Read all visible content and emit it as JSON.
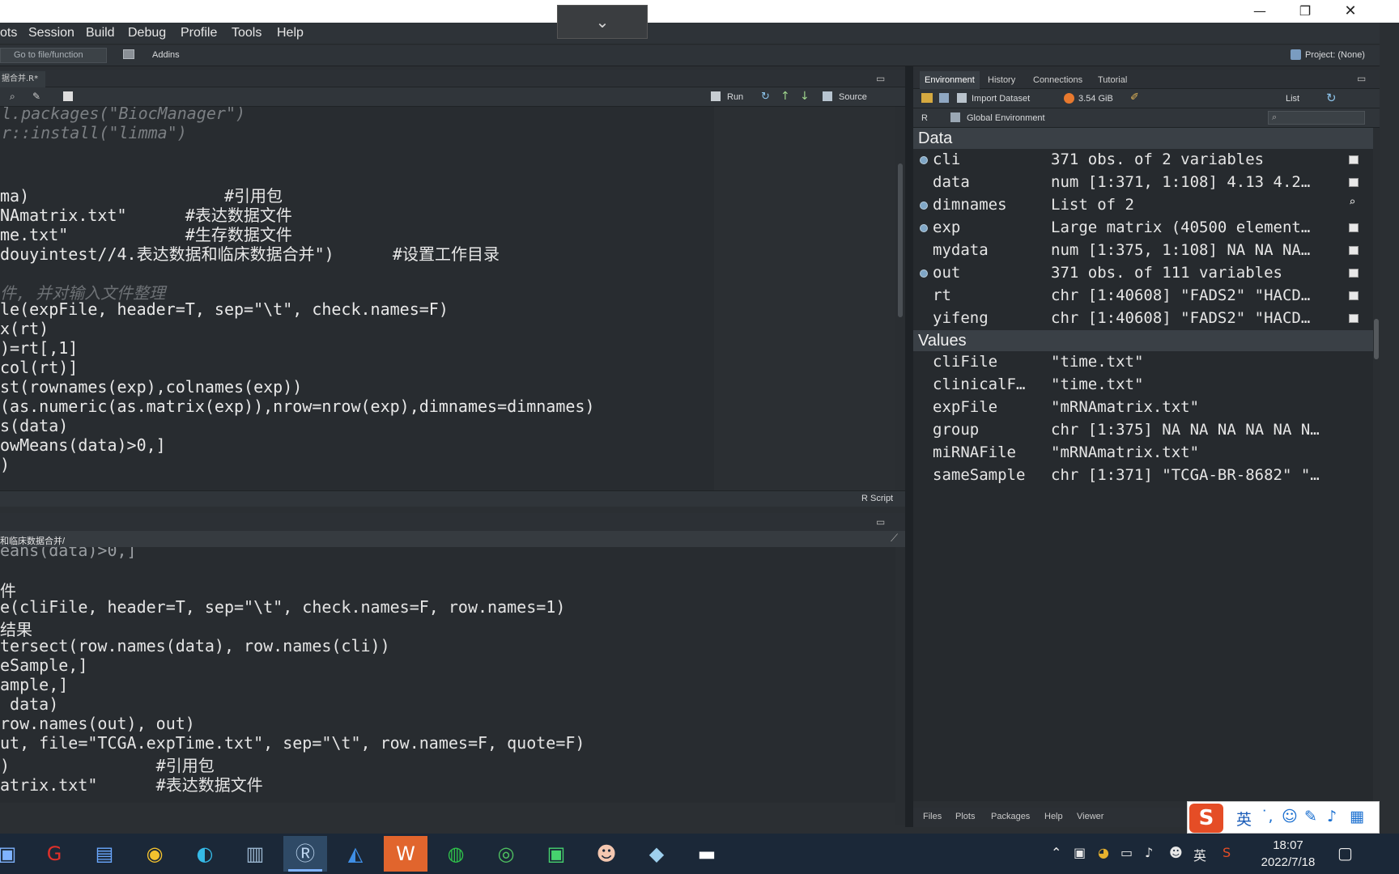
{
  "window": {
    "minimize": "—",
    "restore": "❐",
    "close": "✕",
    "collapse": "⌄"
  },
  "menu": [
    "ots",
    "Session",
    "Build",
    "Debug",
    "Profile",
    "Tools",
    "Help"
  ],
  "toolbar": {
    "goto_placeholder": "Go to file/function",
    "addins": "Addins",
    "project": "Project: (None)"
  },
  "editor": {
    "tab": "据合并.R*",
    "run": "Run",
    "source": "Source",
    "mode": "R Script",
    "lines": [
      "l.packages(\"BiocManager\")",
      "r::install(\"limma\")",
      "",
      "ma)                    #引用包",
      "NAmatrix.txt\"      #表达数据文件",
      "me.txt\"            #生存数据文件",
      "douyintest//4.表达数据和临床数据合并\")      #设置工作目录",
      "",
      "件, 并对输入文件整理",
      "le(expFile, header=T, sep=\"\\t\", check.names=F)",
      "x(rt)",
      ")=rt[,1]",
      "col(rt)]",
      "st(rownames(exp),colnames(exp))",
      "(as.numeric(as.matrix(exp)),nrow=nrow(exp),dimnames=dimnames)",
      "s(data)",
      "owMeans(data)>0,]",
      ")"
    ]
  },
  "console": {
    "path": "和临床数据合并/",
    "lines": [
      "eans(data)>0,]",
      "",
      "件",
      "e(cliFile, header=T, sep=\"\\t\", check.names=F, row.names=1)",
      "结果",
      "tersect(row.names(data), row.names(cli))",
      "eSample,]",
      "ample,]",
      " data)",
      "row.names(out), out)",
      "ut, file=\"TCGA.expTime.txt\", sep=\"\\t\", row.names=F, quote=F)",
      ")               #引用包",
      "atrix.txt\"      #表达数据文件"
    ]
  },
  "env": {
    "tabs": [
      "Environment",
      "History",
      "Connections",
      "Tutorial"
    ],
    "import": "Import Dataset",
    "memory": "3.54 GiB",
    "view_mode": "List",
    "lang": "R",
    "scope": "Global Environment",
    "data_header": "Data",
    "values_header": "Values",
    "data": [
      {
        "name": "cli",
        "value": "371 obs. of 2 variables",
        "bullet": true
      },
      {
        "name": "data",
        "value": "num [1:371, 1:108] 4.13 4.2…",
        "bullet": false
      },
      {
        "name": "dimnames",
        "value": "List of  2",
        "bullet": true
      },
      {
        "name": "exp",
        "value": "Large matrix (40500 element…",
        "bullet": true
      },
      {
        "name": "mydata",
        "value": "num [1:375, 1:108] NA NA NA…",
        "bullet": false
      },
      {
        "name": "out",
        "value": "371 obs. of 111 variables",
        "bullet": true
      },
      {
        "name": "rt",
        "value": "chr [1:40608] \"FADS2\" \"HACD…",
        "bullet": false
      },
      {
        "name": "yifeng",
        "value": "chr [1:40608] \"FADS2\" \"HACD…",
        "bullet": false
      }
    ],
    "values": [
      {
        "name": "cliFile",
        "value": "\"time.txt\""
      },
      {
        "name": "clinicalF…",
        "value": "\"time.txt\""
      },
      {
        "name": "expFile",
        "value": "\"mRNAmatrix.txt\""
      },
      {
        "name": "group",
        "value": "chr [1:375] NA NA NA NA NA N…"
      },
      {
        "name": "miRNAFile",
        "value": "\"mRNAmatrix.txt\""
      },
      {
        "name": "sameSample",
        "value": "chr [1:371] \"TCGA-BR-8682\" \"…"
      }
    ]
  },
  "files_tabs": [
    "Files",
    "Plots",
    "Packages",
    "Help",
    "Viewer"
  ],
  "ime": {
    "lang": "英",
    "logo": "S"
  },
  "tray": {
    "lang": "英"
  },
  "clock": {
    "time": "18:07",
    "date": "2022/7/18"
  }
}
